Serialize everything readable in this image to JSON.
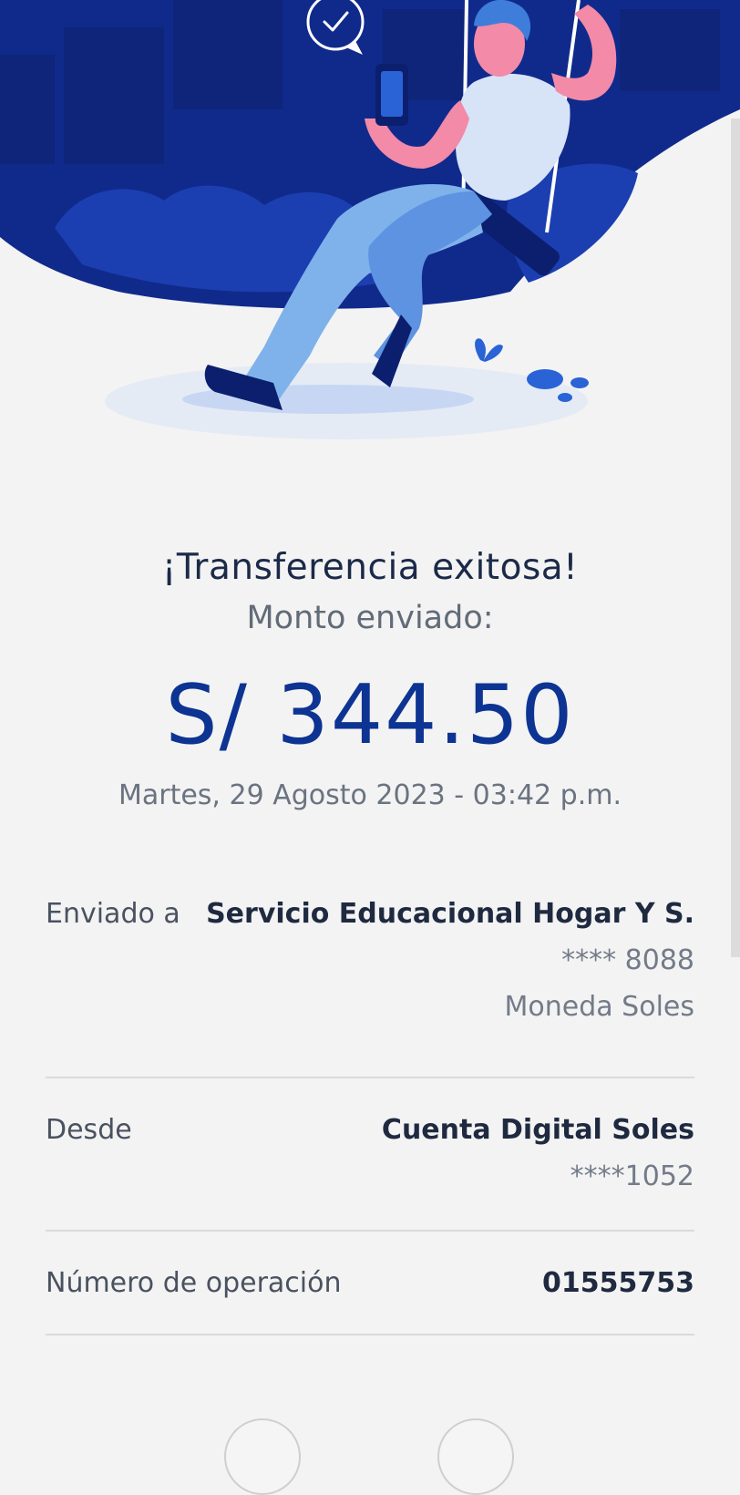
{
  "status": {
    "title": "¡Transferencia exitosa!",
    "subtitle": "Monto enviado:"
  },
  "transfer": {
    "amount": "S/ 344.50",
    "datetime": "Martes, 29 Agosto 2023 - 03:42 p.m."
  },
  "details": {
    "recipient": {
      "label": "Enviado a",
      "name": "Servicio Educacional Hogar Y S.",
      "account": "**** 8088",
      "currency": "Moneda Soles"
    },
    "source": {
      "label": "Desde",
      "account_name": "Cuenta Digital Soles",
      "account_number": "****1052"
    },
    "operation": {
      "label": "Número de operación",
      "number": "01555753"
    }
  },
  "colors": {
    "brand_dark": "#102a8c",
    "amount_blue": "#0d3493",
    "background": "#f3f3f3"
  },
  "icons": {
    "hero": "person-on-swing-illustration",
    "badge": "checkmark-chat-bubble-icon"
  }
}
